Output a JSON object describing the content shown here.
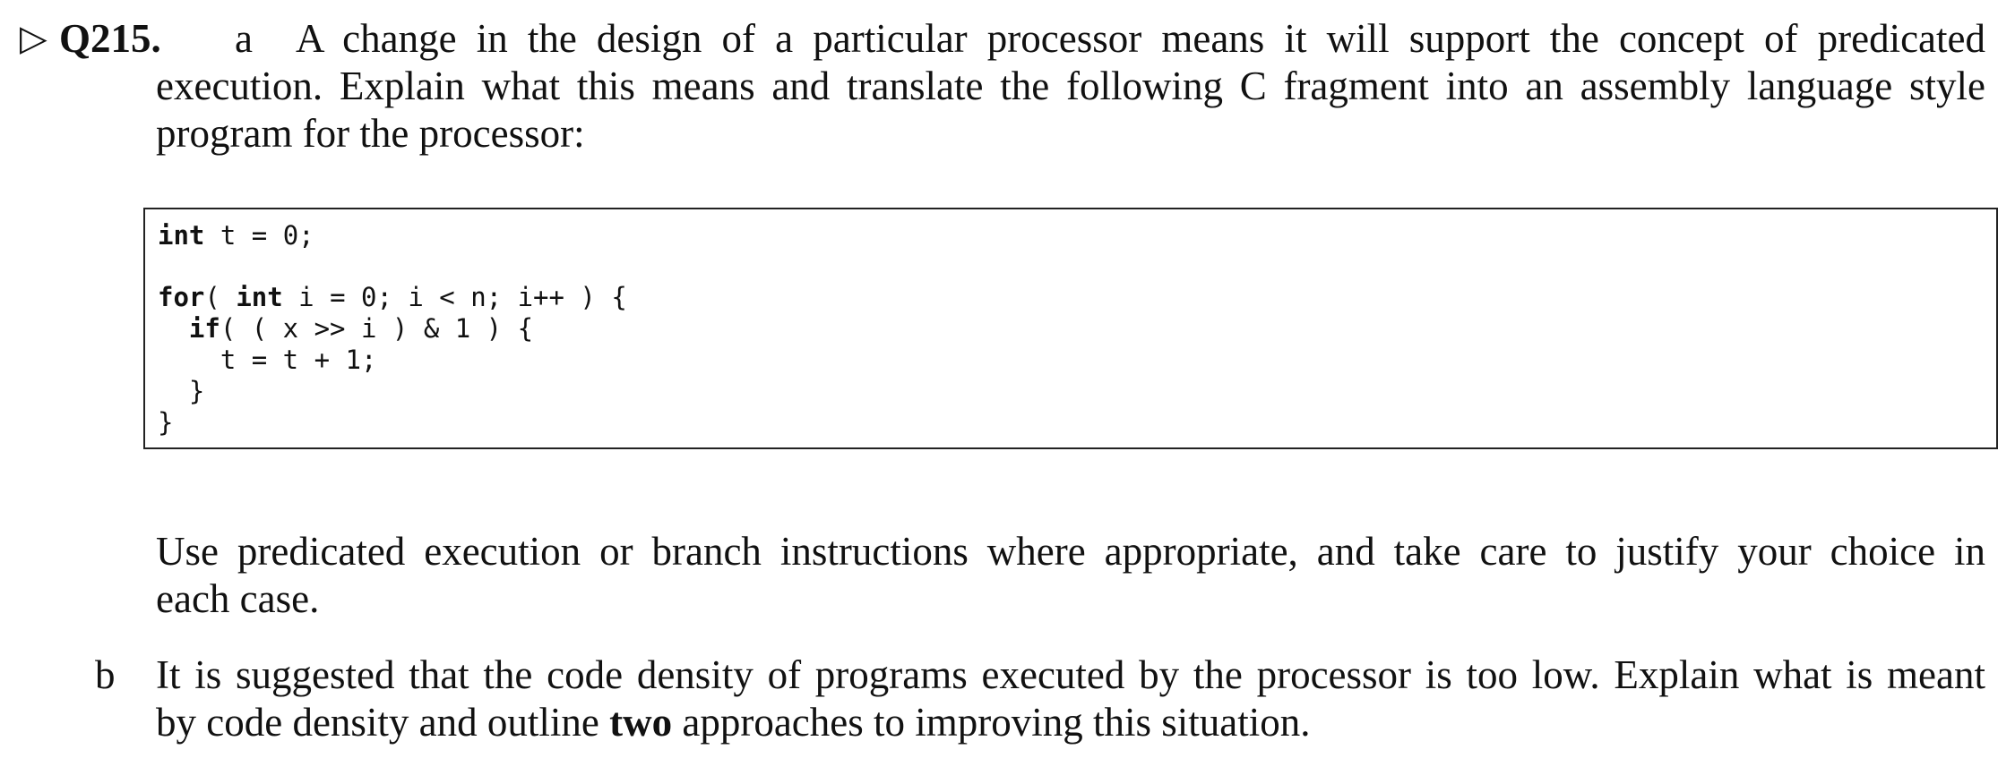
{
  "question": {
    "marker": "▷",
    "number": "Q215.",
    "part_a": {
      "label": "a",
      "intro_line1": "A change in the design of a particular processor means it will support the concept of predicated",
      "intro_line2": "execution. Explain what this means and translate the following C fragment into an assembly language style",
      "intro_line3": "program for the processor:",
      "code": {
        "line1_kw": "int",
        "line1_rest": " t = 0;",
        "line2_kw1": "for",
        "line2_mid": "( ",
        "line2_kw2": "int",
        "line2_rest": " i = 0; i < n; i++ ) {",
        "line3_indent": "  ",
        "line3_kw": "if",
        "line3_rest": "( ( x >> i ) & 1 ) {",
        "line4": "    t = t + 1;",
        "line5": "  }",
        "line6": "}"
      },
      "after_line1": "Use predicated execution or branch instructions where appropriate, and take care to justify your choice in",
      "after_line2": "each case."
    },
    "part_b": {
      "label": "b",
      "line1": "It is suggested that the code density of programs executed by the processor is too low. Explain what is meant",
      "line2_before": "by code density and outline ",
      "line2_bold": "two",
      "line2_after": " approaches to improving this situation."
    }
  }
}
